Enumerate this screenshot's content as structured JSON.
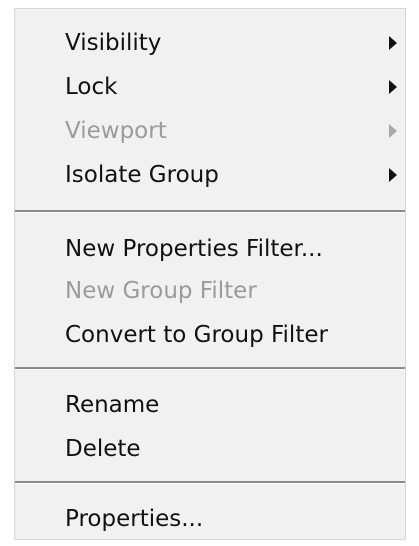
{
  "menu": {
    "groups": [
      {
        "items": [
          {
            "label": "Visibility",
            "enabled": true,
            "submenu": true
          },
          {
            "label": "Lock",
            "enabled": true,
            "submenu": true
          },
          {
            "label": "Viewport",
            "enabled": false,
            "submenu": true
          },
          {
            "label": "Isolate Group",
            "enabled": true,
            "submenu": true
          }
        ]
      },
      {
        "items": [
          {
            "label": "New Properties Filter...",
            "enabled": true,
            "submenu": false
          },
          {
            "label": "New Group Filter",
            "enabled": false,
            "submenu": false
          },
          {
            "label": "Convert to Group Filter",
            "enabled": true,
            "submenu": false
          }
        ]
      },
      {
        "items": [
          {
            "label": "Rename",
            "enabled": true,
            "submenu": false
          },
          {
            "label": "Delete",
            "enabled": true,
            "submenu": false
          }
        ]
      },
      {
        "items": [
          {
            "label": "Properties...",
            "enabled": true,
            "submenu": false
          }
        ]
      }
    ],
    "icons": {
      "submenu": "chevron-right-icon"
    },
    "colors": {
      "background": "#f1f1f1",
      "text": "#111111",
      "disabled_text": "#9b9b9b",
      "separator": "#8a8a8a"
    }
  }
}
